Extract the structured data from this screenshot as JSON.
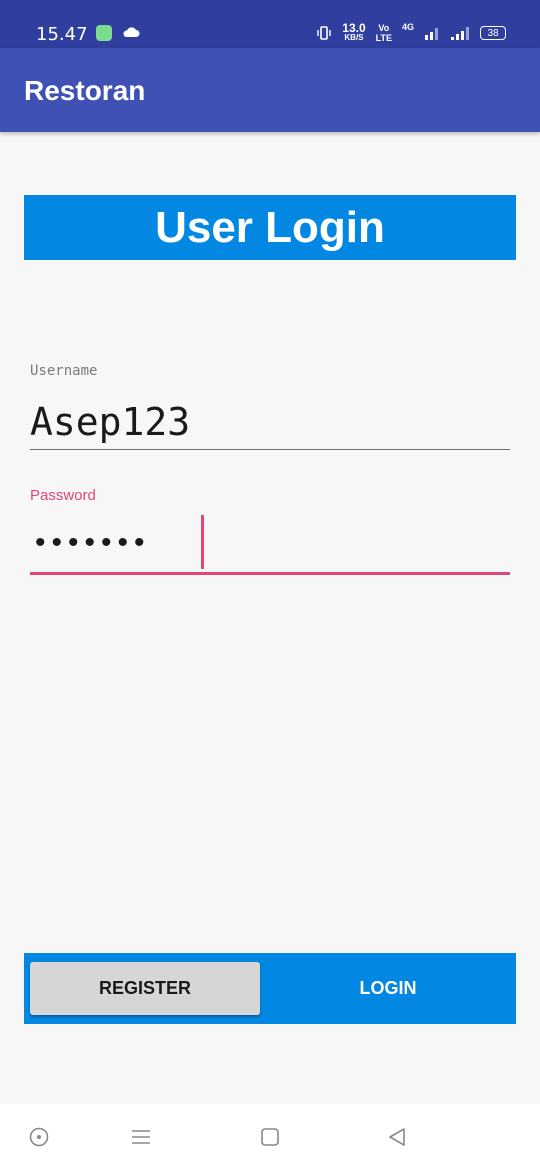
{
  "status_bar": {
    "time": "15.47",
    "net_speed_value": "13.0",
    "net_speed_unit": "KB/S",
    "volte_top": "Vo",
    "volte_bottom": "LTE",
    "network_type": "4G",
    "battery": "38",
    "icons": [
      "notification-app-icon",
      "cloud-icon",
      "vibrate-icon",
      "signal-icon",
      "signal-icon",
      "battery-icon"
    ]
  },
  "app_bar": {
    "title": "Restoran"
  },
  "banner": {
    "title": "User Login"
  },
  "form": {
    "username_label": "Username",
    "username_value": "Asep123",
    "password_label": "Password",
    "password_masked": "•••••••"
  },
  "buttons": {
    "register": "REGISTER",
    "login": "LOGIN"
  },
  "nav_bar": {
    "icons": [
      "recent-apps-icon",
      "menu-icon",
      "home-icon",
      "back-icon"
    ]
  },
  "colors": {
    "status_bar": "#303f9f",
    "app_bar": "#3f51b5",
    "banner": "#0288e2",
    "accent": "#e0457b",
    "register_button": "#d6d6d6"
  }
}
